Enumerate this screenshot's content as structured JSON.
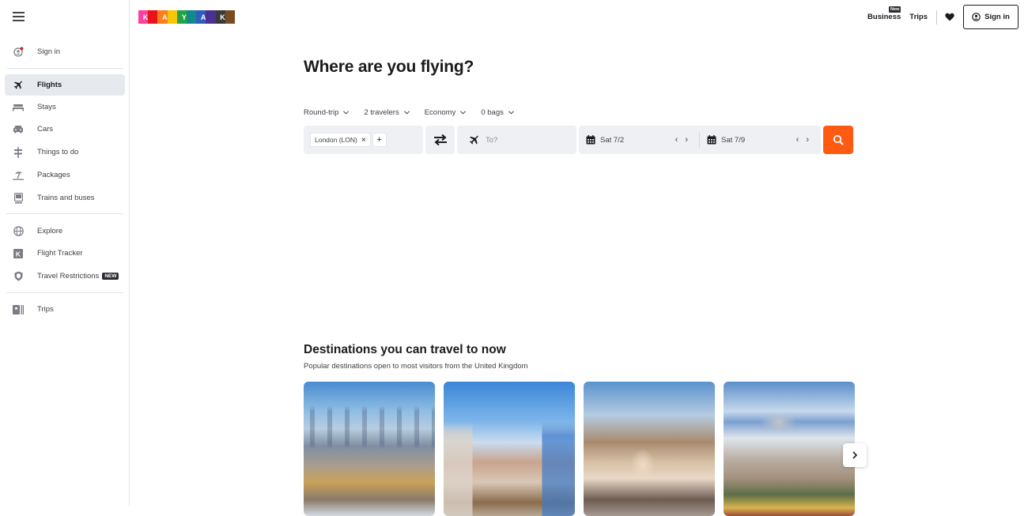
{
  "sidebar": {
    "menu_icon": "hamburger-icon",
    "sign_in": {
      "label": "Sign in",
      "icon": "user-alert-icon"
    },
    "primary_items": [
      {
        "label": "Flights",
        "icon": "plane-icon",
        "active": true
      },
      {
        "label": "Stays",
        "icon": "bed-icon"
      },
      {
        "label": "Cars",
        "icon": "car-icon"
      },
      {
        "label": "Things to do",
        "icon": "signpost-icon"
      },
      {
        "label": "Packages",
        "icon": "beach-umbrella-icon"
      },
      {
        "label": "Trains and buses",
        "icon": "train-icon"
      }
    ],
    "secondary_items": [
      {
        "label": "Explore",
        "icon": "globe-icon"
      },
      {
        "label": "Flight Tracker",
        "icon": "kayak-k-icon"
      },
      {
        "label": "Travel Restrictions",
        "icon": "shield-icon",
        "badge": "NEW"
      }
    ],
    "tertiary_items": [
      {
        "label": "Trips",
        "icon": "trips-icon"
      }
    ]
  },
  "brand": {
    "letters": [
      "K",
      "A",
      "Y",
      "A",
      "K"
    ],
    "colors": [
      "#ff3fa0",
      "#e8131d",
      "#ff7e1a",
      "#f6c600",
      "#21a346",
      "#138a87",
      "#2c5dbf",
      "#4b2f92",
      "#3a3a3a",
      "#7a4b23"
    ]
  },
  "header": {
    "business_label": "Business",
    "business_badge": "New",
    "trips_label": "Trips",
    "heart_icon": "heart-icon",
    "sign_in_label": "Sign in"
  },
  "main": {
    "title": "Where are you flying?",
    "filters": [
      {
        "label": "Round-trip"
      },
      {
        "label": "2 travelers"
      },
      {
        "label": "Economy"
      },
      {
        "label": "0 bags"
      }
    ],
    "search": {
      "origin_chip": "London (LON)",
      "origin_add": "+",
      "destination_placeholder": "To?",
      "destination_value": "",
      "depart_date": "Sat 7/2",
      "return_date": "Sat 7/9",
      "prev_arrow": "‹",
      "next_arrow": "›"
    },
    "accent_color": "#ff5a11"
  },
  "destinations": {
    "title": "Destinations you can travel to now",
    "subtitle": "Popular destinations open to most visitors from the United Kingdom",
    "cards": [
      {
        "alt": "Bangkok skyline with Grand Palace"
      },
      {
        "alt": "Cartagena colonial street with cathedral"
      },
      {
        "alt": "Barcelona Park Güell visitor"
      },
      {
        "alt": "Istanbul skyline with mosques"
      }
    ]
  }
}
